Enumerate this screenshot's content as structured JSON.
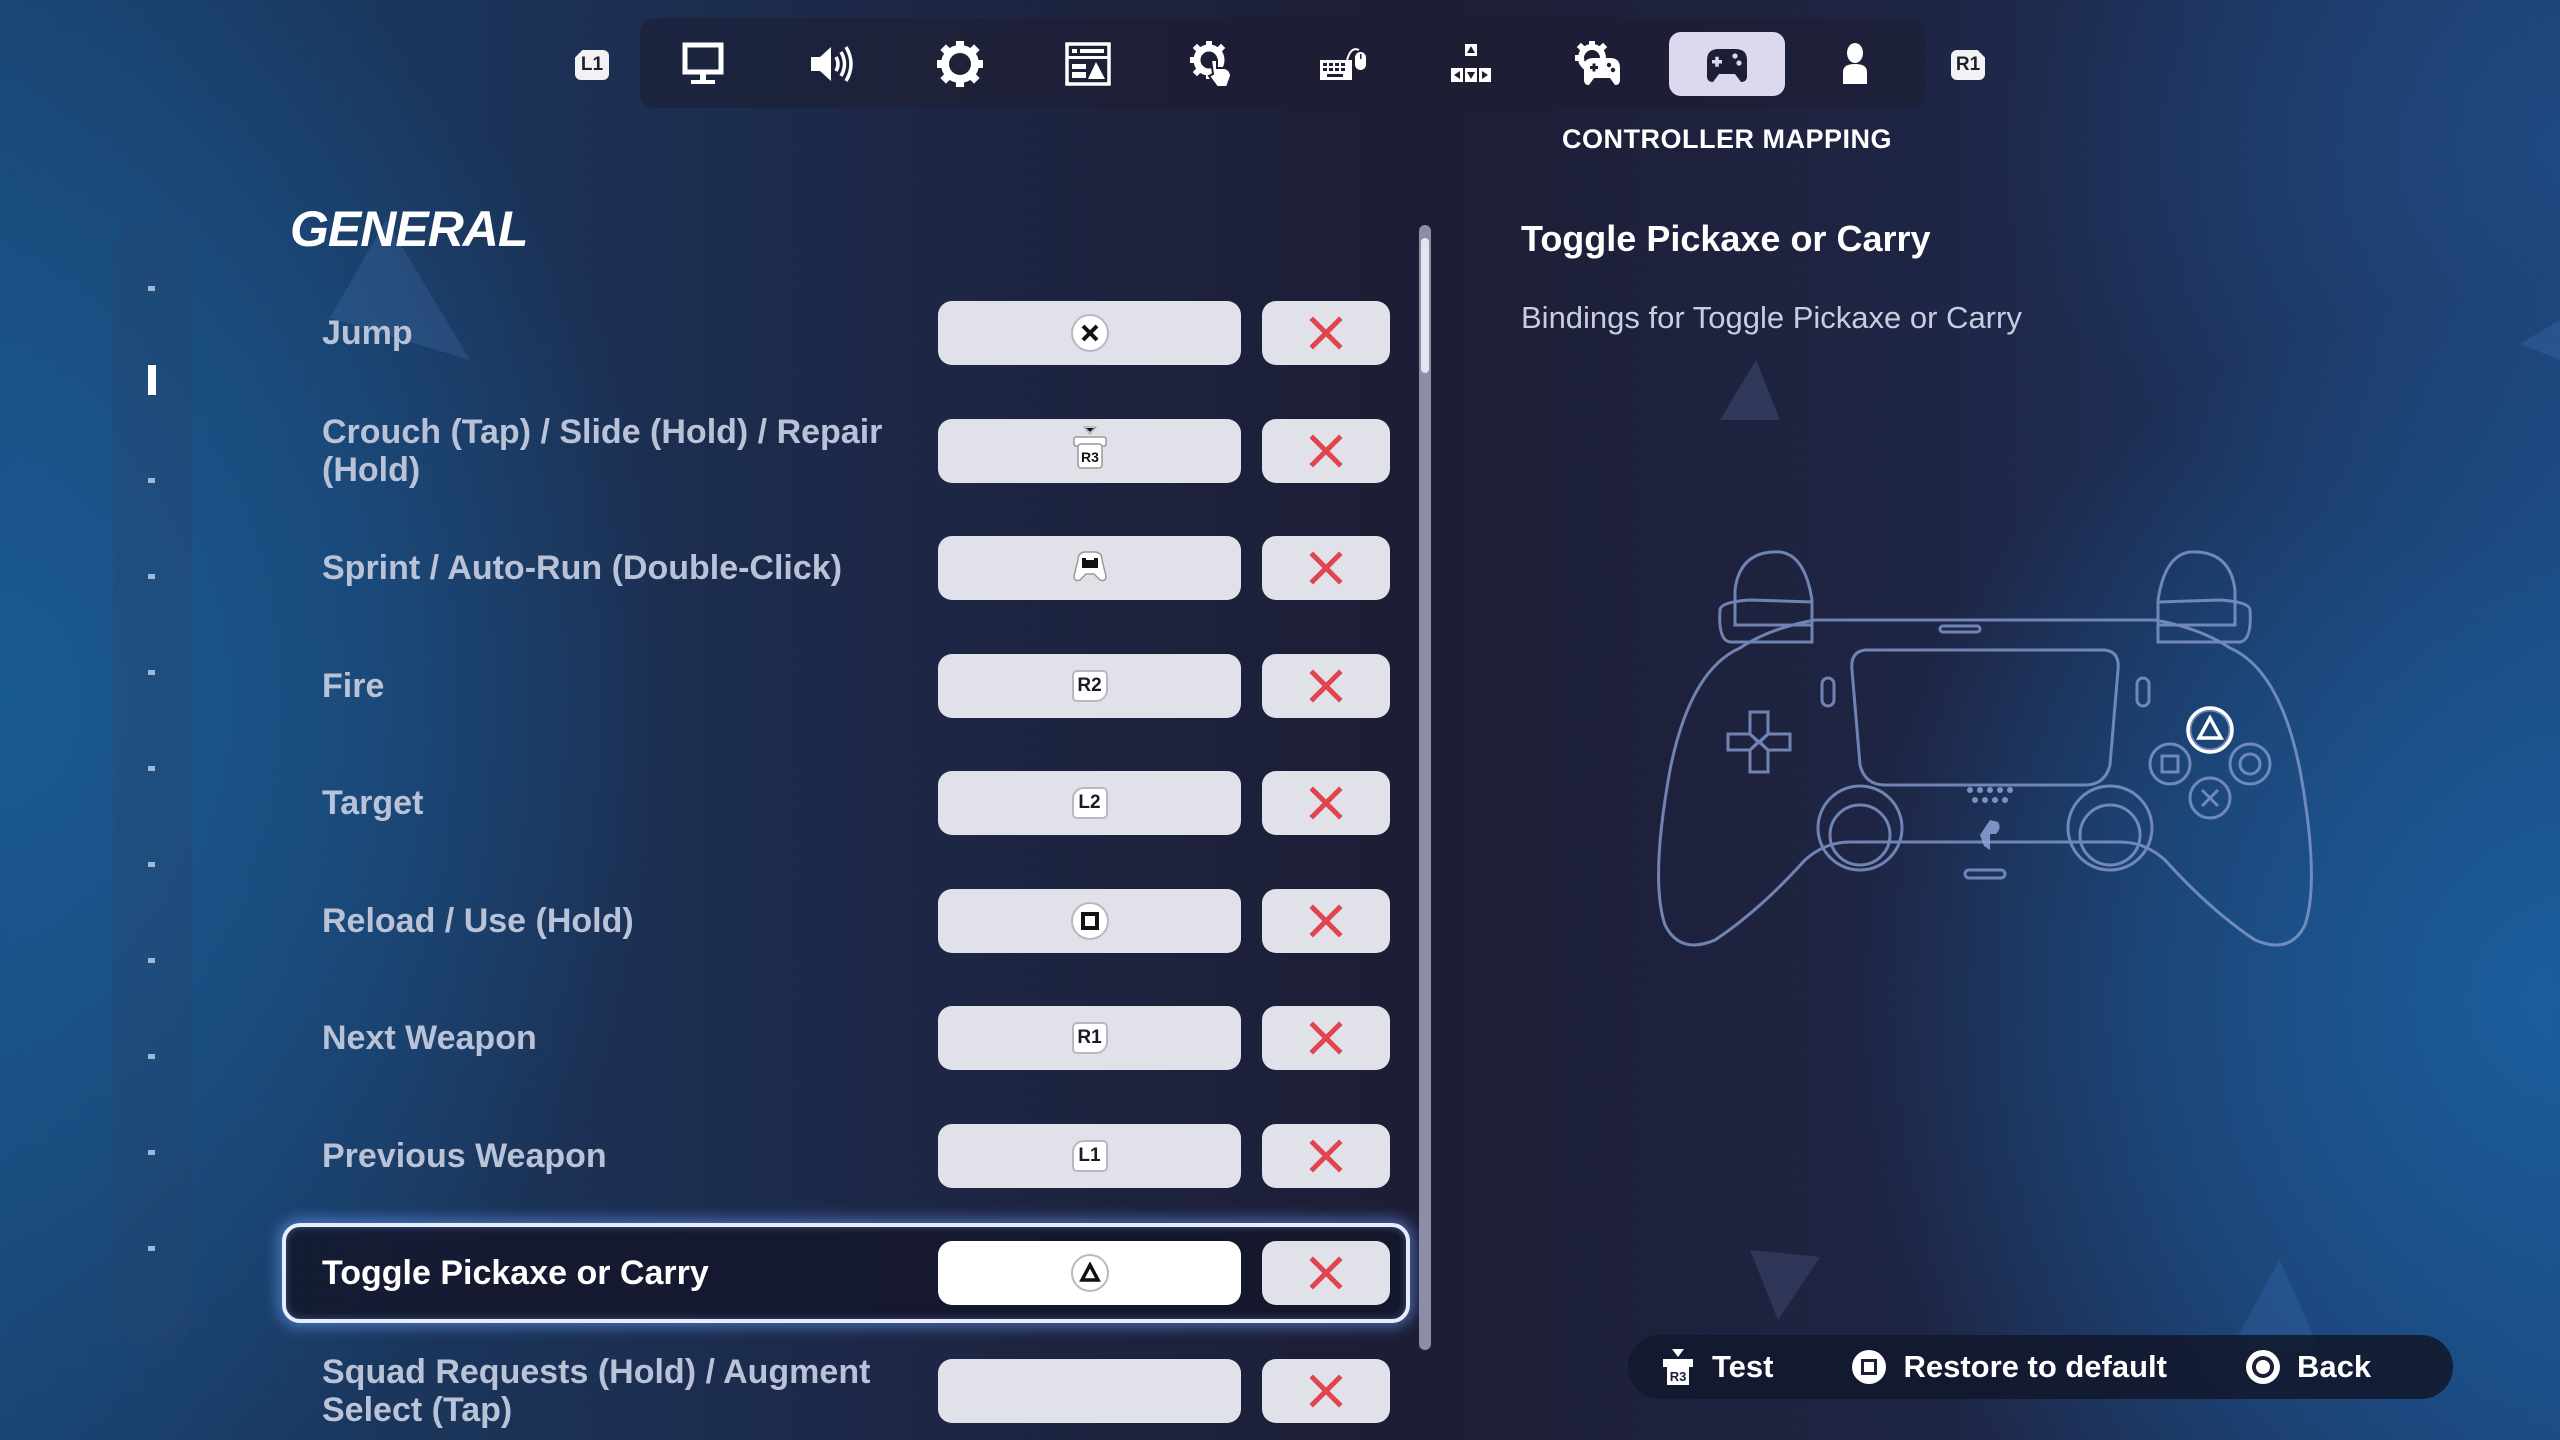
{
  "tabs": {
    "left_bumper": "L1",
    "right_bumper": "R1",
    "items": [
      {
        "icon": "monitor-icon",
        "name": "display"
      },
      {
        "icon": "speaker-icon",
        "name": "audio"
      },
      {
        "icon": "gear-icon",
        "name": "game"
      },
      {
        "icon": "layout-icon",
        "name": "hud"
      },
      {
        "icon": "gear-touch-icon",
        "name": "touch"
      },
      {
        "icon": "keyboard-mouse-icon",
        "name": "keyboard-controls"
      },
      {
        "icon": "dpad-keys-icon",
        "name": "input"
      },
      {
        "icon": "gear-controller-icon",
        "name": "controller-options"
      },
      {
        "icon": "controller-icon",
        "name": "controller-mapping",
        "active": true
      },
      {
        "icon": "person-icon",
        "name": "account"
      }
    ],
    "active_caption": "CONTROLLER MAPPING"
  },
  "section_nav": {
    "count": 11,
    "active_index": 1
  },
  "section": {
    "title": "GENERAL"
  },
  "rows": [
    {
      "label": "Jump",
      "binding": {
        "type": "circle",
        "glyph": "cross",
        "text": "✕"
      }
    },
    {
      "label": "Crouch (Tap) / Slide (Hold) / Repair (Hold)",
      "binding": {
        "type": "stick",
        "glyph": "R3",
        "text": "R3"
      }
    },
    {
      "label": "Sprint / Auto-Run (Double-Click)",
      "binding": {
        "type": "stick",
        "glyph": "L3-press",
        "text": ""
      }
    },
    {
      "label": "Fire",
      "binding": {
        "type": "key-r",
        "glyph": "R2",
        "text": "R2"
      }
    },
    {
      "label": "Target",
      "binding": {
        "type": "key-l",
        "glyph": "L2",
        "text": "L2"
      }
    },
    {
      "label": "Reload / Use (Hold)",
      "binding": {
        "type": "circle",
        "glyph": "square",
        "text": ""
      }
    },
    {
      "label": "Next Weapon",
      "binding": {
        "type": "key-r",
        "glyph": "R1",
        "text": "R1"
      }
    },
    {
      "label": "Previous Weapon",
      "binding": {
        "type": "key-l",
        "glyph": "L1",
        "text": "L1"
      }
    },
    {
      "label": "Toggle Pickaxe or Carry",
      "binding": {
        "type": "circle",
        "glyph": "triangle",
        "text": ""
      },
      "selected": true
    },
    {
      "label": "Squad Requests (Hold) / Augment Select (Tap)",
      "binding": {
        "type": "empty",
        "glyph": "",
        "text": ""
      }
    }
  ],
  "detail": {
    "title": "Toggle Pickaxe or Carry",
    "description": "Bindings for Toggle Pickaxe or Carry",
    "highlighted_button": "triangle"
  },
  "footer": {
    "test": {
      "button": "R3",
      "label": "Test"
    },
    "restore": {
      "button": "square",
      "label": "Restore to default"
    },
    "back": {
      "button": "circle",
      "label": "Back"
    }
  },
  "colors": {
    "clear_x": "#e0444f",
    "active_tab_bg": "#dcd9ee",
    "label_text": "#b9c2d6"
  }
}
